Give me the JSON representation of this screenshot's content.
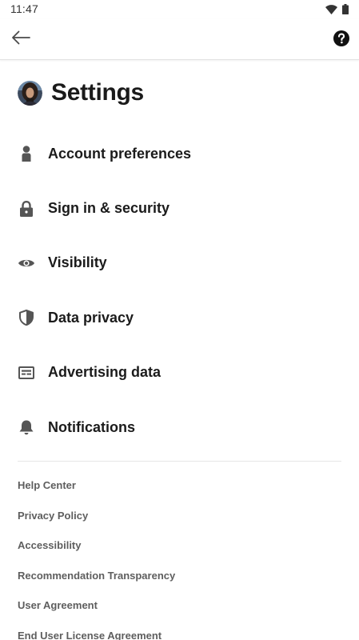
{
  "status_bar": {
    "time": "11:47",
    "icons": [
      "wifi-icon",
      "battery-icon"
    ]
  },
  "app_bar": {
    "back_icon": "arrow-left-icon",
    "help_icon": "question-circle-icon"
  },
  "header": {
    "title": "Settings",
    "avatar": "profile-avatar"
  },
  "menu": {
    "items": [
      {
        "label": "Account preferences",
        "icon": "person-icon"
      },
      {
        "label": "Sign in & security",
        "icon": "lock-icon"
      },
      {
        "label": "Visibility",
        "icon": "eye-icon"
      },
      {
        "label": "Data privacy",
        "icon": "shield-icon"
      },
      {
        "label": "Advertising data",
        "icon": "newspaper-icon"
      },
      {
        "label": "Notifications",
        "icon": "bell-icon"
      }
    ]
  },
  "links": {
    "items": [
      {
        "label": "Help Center"
      },
      {
        "label": "Privacy Policy"
      },
      {
        "label": "Accessibility"
      },
      {
        "label": "Recommendation Transparency"
      },
      {
        "label": "User Agreement"
      },
      {
        "label": "End User License Agreement"
      }
    ]
  },
  "colors": {
    "text_primary": "#1b1b1b",
    "text_secondary": "#5e5e5e",
    "icon": "#555555",
    "divider": "#e6e6e6"
  }
}
